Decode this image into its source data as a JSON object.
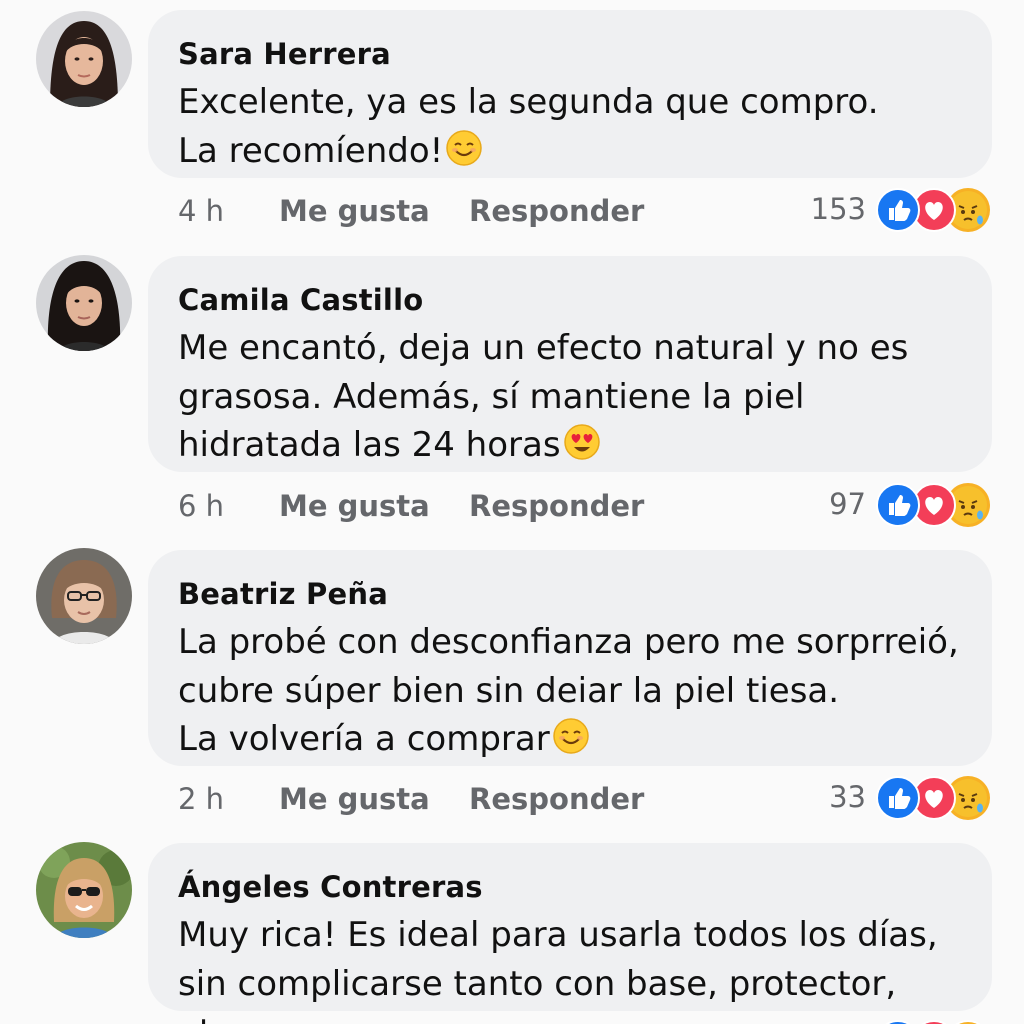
{
  "comments": [
    {
      "author": "Sara Herrera",
      "text": "Excelente, ya es la segunda que compro.\nLa recomíendo!",
      "emoji": "smiling-face-icon",
      "time": "4 h",
      "like_label": "Me gusta",
      "reply_label": "Responder",
      "reaction_count": "153"
    },
    {
      "author": "Camila Castillo",
      "text": "Me encantó, deja un efecto natural y no es\ngrasosa. Además, sí mantiene la piel\nhidratada las 24 horas",
      "emoji": "heart-eyes-face-icon",
      "time": "6 h",
      "like_label": "Me gusta",
      "reply_label": "Responder",
      "reaction_count": "97"
    },
    {
      "author": "Beatriz Peña",
      "text": "La probé con desconfianza pero me sorprreió,\ncubre súper bien sin deiar la piel tiesa.\nLa volvería a comprar",
      "emoji": "smiling-face-icon",
      "time": "2 h",
      "like_label": "Me gusta",
      "reply_label": "Responder",
      "reaction_count": "33"
    },
    {
      "author": "Ángeles Contreras",
      "text": "Muy rica! Es ideal para usarla todos los días,\nsin complicarse tanto con base, protector, etc.",
      "emoji": "",
      "time": "",
      "like_label": "",
      "reply_label": "",
      "reaction_count": ""
    }
  ],
  "reaction_icons": [
    "like-icon",
    "love-icon",
    "care-icon"
  ],
  "colors": {
    "bubble": "#eff0f2",
    "background": "#fafafa",
    "like_blue": "#1877f2",
    "love_red": "#f33e58",
    "care_yellow": "#f7b125",
    "meta_gray": "#65676b"
  }
}
